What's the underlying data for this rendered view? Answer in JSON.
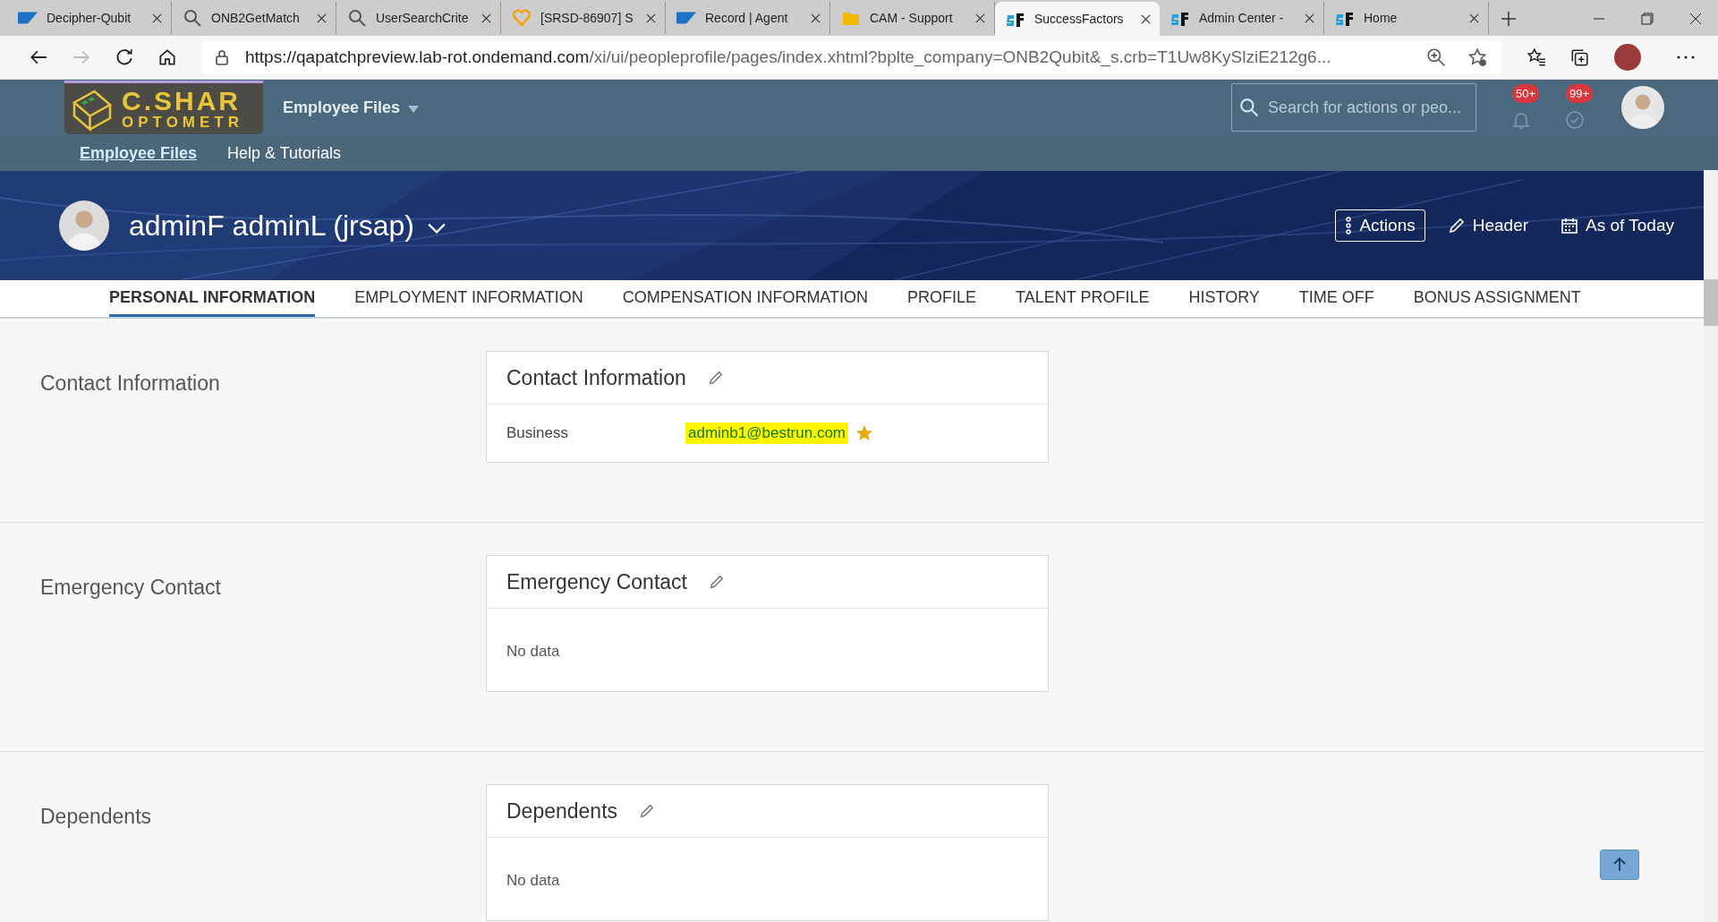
{
  "browser": {
    "tabs": [
      {
        "title": "Decipher-Qubit",
        "kind": "sap",
        "selected": false
      },
      {
        "title": "ONB2GetMatch",
        "kind": "search",
        "selected": false
      },
      {
        "title": "UserSearchCrite",
        "kind": "search",
        "selected": false
      },
      {
        "title": "[SRSD-86907] S",
        "kind": "heart",
        "selected": false
      },
      {
        "title": "Record | Agent",
        "kind": "sap",
        "selected": false
      },
      {
        "title": "CAM - Support",
        "kind": "folder",
        "selected": false
      },
      {
        "title": "SuccessFactors",
        "kind": "sf",
        "selected": true
      },
      {
        "title": "Admin Center -",
        "kind": "sf",
        "selected": false
      },
      {
        "title": "Home",
        "kind": "sf",
        "selected": false
      }
    ],
    "url_host": "https://qapatchpreview.lab-rot.ondemand.com",
    "url_path": "/xi/ui/peopleprofile/pages/index.xhtml?bplte_company=ONB2Qubit&_s.crb=T1Uw8KySlziE212g6..."
  },
  "header": {
    "logo_line1": "C.SHAR",
    "logo_line2": "OPTOMETR",
    "module": "Employee Files",
    "search": {
      "placeholder": "Search for actions or peo..."
    },
    "indicators": [
      {
        "kind": "bell",
        "badge": "50+"
      },
      {
        "kind": "check",
        "badge": "99+"
      }
    ],
    "nav": [
      {
        "label": "Employee Files",
        "selected": true
      },
      {
        "label": "Help & Tutorials",
        "selected": false
      }
    ]
  },
  "profile": {
    "name": "adminF adminL (jrsap)",
    "buttons": [
      {
        "label": "Actions",
        "kind": "more"
      },
      {
        "label": "Header",
        "kind": "pencil"
      },
      {
        "label": "As of Today",
        "kind": "calendar"
      }
    ]
  },
  "tabs": [
    {
      "label": "PERSONAL INFORMATION",
      "selected": true
    },
    {
      "label": "EMPLOYMENT INFORMATION",
      "selected": false
    },
    {
      "label": "COMPENSATION INFORMATION",
      "selected": false
    },
    {
      "label": "PROFILE",
      "selected": false
    },
    {
      "label": "TALENT PROFILE",
      "selected": false
    },
    {
      "label": "HISTORY",
      "selected": false
    },
    {
      "label": "TIME OFF",
      "selected": false
    },
    {
      "label": "BONUS ASSIGNMENT",
      "selected": false
    }
  ],
  "sections": [
    {
      "title": "Contact Information",
      "card_title": "Contact Information",
      "rows": [
        {
          "label": "Business",
          "value": "adminb1@bestrun.com",
          "highlighted": true,
          "primary": true
        }
      ]
    },
    {
      "title": "Emergency Contact",
      "card_title": "Emergency Contact",
      "empty_text": "No data"
    },
    {
      "title": "Dependents",
      "card_title": "Dependents",
      "empty_text": "No data"
    }
  ]
}
